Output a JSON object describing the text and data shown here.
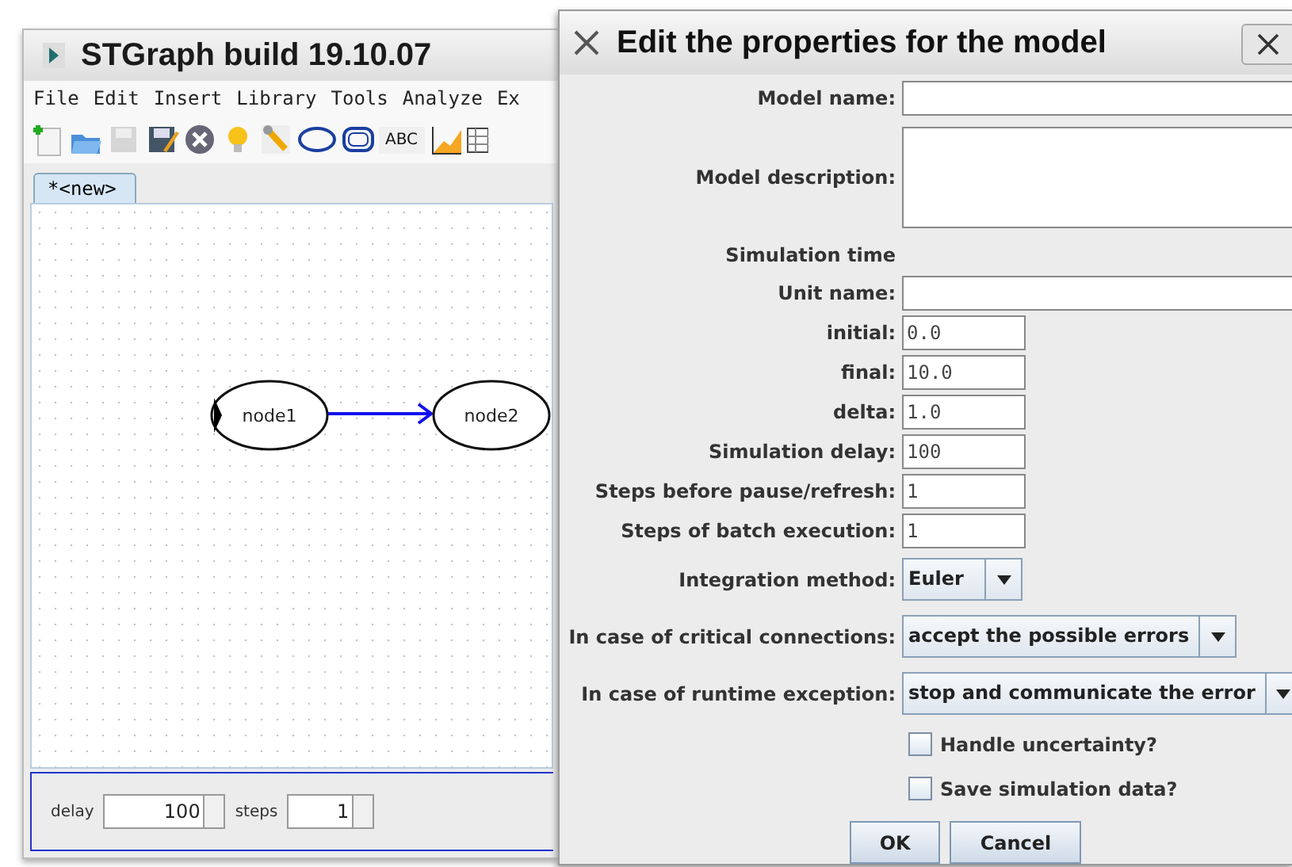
{
  "main_window": {
    "title": "STGraph build 19.10.07",
    "menu": [
      "File",
      "Edit",
      "Insert",
      "Library",
      "Tools",
      "Analyze",
      "Ex"
    ],
    "toolbar": [
      {
        "kind": "new"
      },
      {
        "kind": "open"
      },
      {
        "kind": "save",
        "disabled": true
      },
      {
        "kind": "edit"
      },
      {
        "kind": "close"
      },
      {
        "kind": "bulb"
      },
      {
        "kind": "wrench"
      },
      {
        "kind": "ellipse"
      },
      {
        "kind": "roundrect"
      },
      {
        "kind": "text",
        "label": "ABC"
      },
      {
        "kind": "chart"
      },
      {
        "kind": "table"
      }
    ],
    "tabs": [
      {
        "label": "*<new>",
        "selected": true
      }
    ],
    "nodes": [
      {
        "label": "node1",
        "marked": true
      },
      {
        "label": "node2",
        "marked": false
      }
    ],
    "delay": {
      "label": "delay",
      "value": "100"
    },
    "steps": {
      "label": "steps",
      "value": "1"
    }
  },
  "dialog": {
    "title": "Edit the properties for the model",
    "fields": [
      {
        "kind": "widetext",
        "label": "Model name:"
      },
      {
        "kind": "textarea",
        "label": "Model description:"
      },
      {
        "kind": "heading",
        "label": "Simulation time"
      },
      {
        "kind": "widetext",
        "label": "Unit name:"
      },
      {
        "kind": "text",
        "label": "initial:",
        "value": "0.0"
      },
      {
        "kind": "text",
        "label": "final:",
        "value": "10.0"
      },
      {
        "kind": "text",
        "label": "delta:",
        "value": "1.0"
      },
      {
        "kind": "text",
        "label": "Simulation delay:",
        "value": "100"
      },
      {
        "kind": "text",
        "label": "Steps before pause/refresh:",
        "value": "1"
      },
      {
        "kind": "text",
        "label": "Steps of batch execution:",
        "value": "1"
      },
      {
        "kind": "combo",
        "label": "Integration method:",
        "value": "Euler"
      },
      {
        "kind": "combo",
        "label": "In case of critical connections:",
        "value": "accept the possible errors"
      },
      {
        "kind": "combo",
        "label": "In case of runtime exception:",
        "value": "stop and communicate the error"
      },
      {
        "kind": "checkbox",
        "label": "Handle uncertainty?",
        "checked": false
      },
      {
        "kind": "checkbox",
        "label": "Save simulation data?",
        "checked": false
      }
    ],
    "buttons": [
      "OK",
      "Cancel"
    ]
  }
}
